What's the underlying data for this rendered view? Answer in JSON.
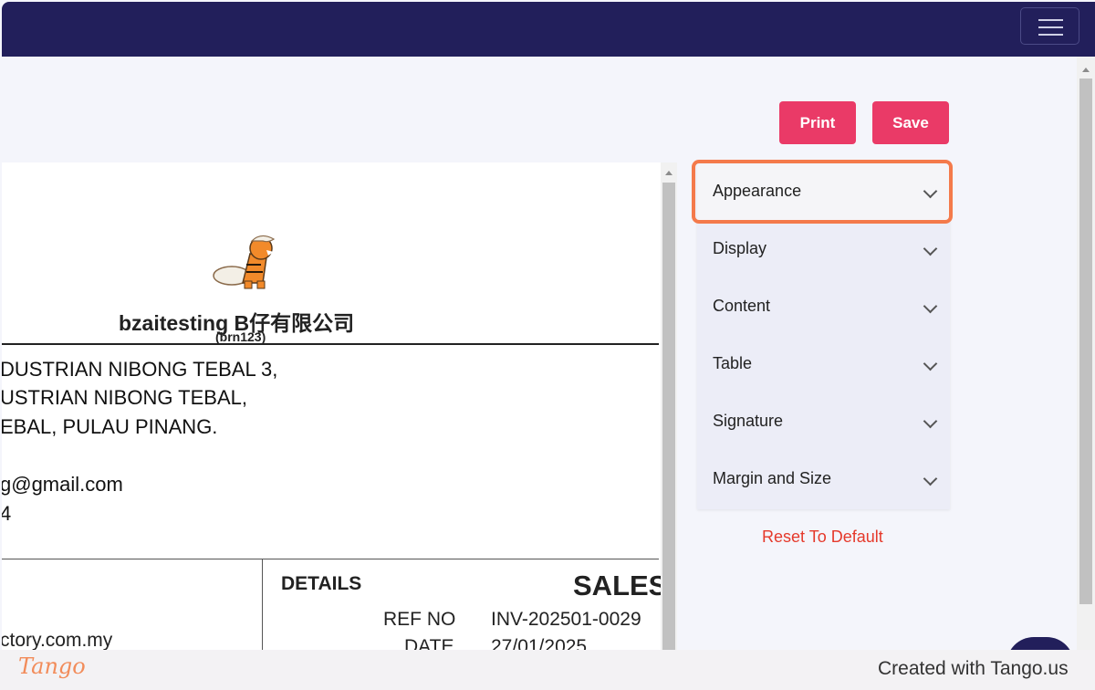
{
  "toolbar": {
    "print_label": "Print",
    "save_label": "Save"
  },
  "document": {
    "company_name": "bzaitesting B仔有限公司",
    "brn": "(brn123)",
    "address_lines": [
      "DUSTRIAN NIBONG TEBAL 3,",
      "USTRIAN NIBONG TEBAL,",
      "EBAL, PULAU PINANG."
    ],
    "email": "g@gmail.com",
    "phone_fragment": "4",
    "website_fragment": "ctory.com.my",
    "details_heading": "DETAILS",
    "sales_heading": "SALES",
    "ref_no_label": "REF NO",
    "ref_no_value": "INV-202501-0029",
    "date_label": "DATE",
    "date_value": "27/01/2025"
  },
  "settings_panel": {
    "items": [
      {
        "label": "Appearance"
      },
      {
        "label": "Display"
      },
      {
        "label": "Content"
      },
      {
        "label": "Table"
      },
      {
        "label": "Signature"
      },
      {
        "label": "Margin and Size"
      }
    ],
    "reset_label": "Reset To Default"
  },
  "footer": {
    "brand": "Tango",
    "created_text": "Created with Tango.us"
  },
  "colors": {
    "navbar": "#221f5b",
    "primary_button": "#ea3a67",
    "highlight": "#f47a4b",
    "reset_link": "#e5392b"
  },
  "icons": {
    "menu": "hamburger-icon",
    "accordion": "chevron-down-icon"
  }
}
